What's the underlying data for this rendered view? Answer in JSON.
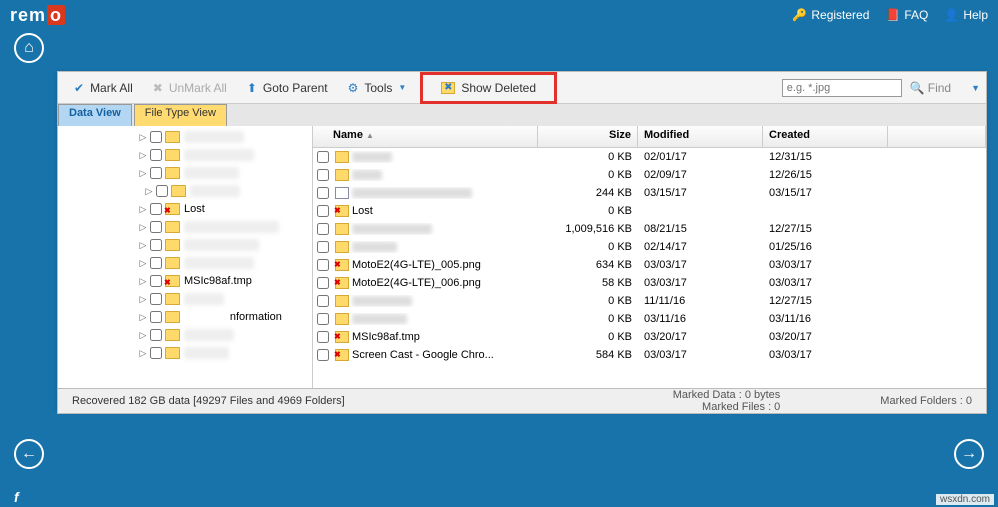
{
  "brand": {
    "text": "rem",
    "accent": "o"
  },
  "header": {
    "registered": "Registered",
    "faq": "FAQ",
    "help": "Help"
  },
  "toolbar": {
    "mark_all": "Mark All",
    "unmark_all": "UnMark All",
    "goto_parent": "Goto Parent",
    "tools": "Tools",
    "show_deleted": "Show Deleted",
    "search_placeholder": "e.g. *.jpg",
    "find": "Find"
  },
  "tabs": {
    "data_view": "Data View",
    "file_type_view": "File Type View"
  },
  "tree": {
    "items": [
      {
        "indent": 80,
        "label": "",
        "blur_w": 60
      },
      {
        "indent": 80,
        "label": "",
        "blur_w": 70
      },
      {
        "indent": 80,
        "label": "",
        "blur_w": 55
      },
      {
        "indent": 86,
        "label": "",
        "blur_w": 50
      },
      {
        "indent": 80,
        "label": "Lost",
        "deleted": true
      },
      {
        "indent": 80,
        "label": "",
        "blur_w": 95
      },
      {
        "indent": 80,
        "label": "",
        "blur_w": 75
      },
      {
        "indent": 80,
        "label": "",
        "blur_w": 70
      },
      {
        "indent": 80,
        "label": "MSIc98af.tmp",
        "deleted": true
      },
      {
        "indent": 80,
        "label": "",
        "blur_w": 40
      },
      {
        "indent": 80,
        "label": "nformation",
        "pad_label": true
      },
      {
        "indent": 80,
        "label": "",
        "blur_w": 50
      },
      {
        "indent": 80,
        "label": "",
        "blur_w": 45
      }
    ]
  },
  "columns": {
    "name": "Name",
    "size": "Size",
    "modified": "Modified",
    "created": "Created"
  },
  "rows": [
    {
      "name_blur": 40,
      "size": "0 KB",
      "modified": "02/01/17",
      "created": "12/31/15"
    },
    {
      "name_blur": 30,
      "size": "0 KB",
      "modified": "02/09/17",
      "created": "12/26/15"
    },
    {
      "name_blur": 120,
      "size": "244 KB",
      "modified": "03/15/17",
      "created": "03/15/17",
      "icon": "doc"
    },
    {
      "name": "Lost",
      "size": "0 KB",
      "modified": "",
      "created": "",
      "deleted": true
    },
    {
      "name_blur": 80,
      "size": "1,009,516 KB",
      "modified": "08/21/15",
      "created": "12/27/15",
      "icon": "zip"
    },
    {
      "name_blur": 45,
      "size": "0 KB",
      "modified": "02/14/17",
      "created": "01/25/16"
    },
    {
      "name": "MotoE2(4G-LTE)_005.png",
      "size": "634 KB",
      "modified": "03/03/17",
      "created": "03/03/17",
      "deleted": true
    },
    {
      "name": "MotoE2(4G-LTE)_006.png",
      "size": "58 KB",
      "modified": "03/03/17",
      "created": "03/03/17",
      "deleted": true
    },
    {
      "name_blur": 60,
      "size": "0 KB",
      "modified": "11/11/16",
      "created": "12/27/15"
    },
    {
      "name_blur": 55,
      "size": "0 KB",
      "modified": "03/11/16",
      "created": "03/11/16"
    },
    {
      "name": "MSIc98af.tmp",
      "size": "0 KB",
      "modified": "03/20/17",
      "created": "03/20/17",
      "deleted": true
    },
    {
      "name": "Screen Cast - Google Chro...",
      "size": "584 KB",
      "modified": "03/03/17",
      "created": "03/03/17",
      "deleted": true
    }
  ],
  "status": {
    "recovered": "Recovered 182 GB data [49297 Files and 4969 Folders]",
    "marked_data": "Marked Data : 0 bytes",
    "marked_files": "Marked Files : 0",
    "marked_folders": "Marked Folders : 0"
  },
  "footer": {
    "f": "f"
  },
  "watermark": "wsxdn.com"
}
